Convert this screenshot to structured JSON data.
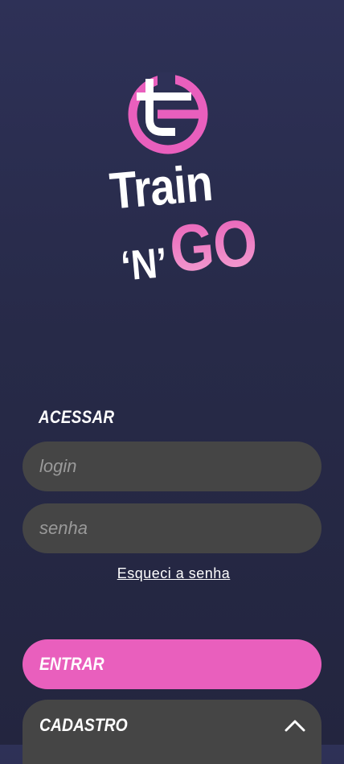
{
  "brand": {
    "line1": "Train",
    "line2_n": "‘N’",
    "line2_go": "GO",
    "logo_icon": "train-n-go-logo-icon",
    "accent_color": "#e95fbd"
  },
  "login": {
    "section_title": "ACESSAR",
    "login_placeholder": "login",
    "login_value": "",
    "password_placeholder": "senha",
    "password_value": "",
    "forgot_password": "Esqueci a senha",
    "submit_label": "ENTRAR"
  },
  "signup": {
    "label": "CADASTRO",
    "toggle_icon": "chevron-up-icon"
  }
}
